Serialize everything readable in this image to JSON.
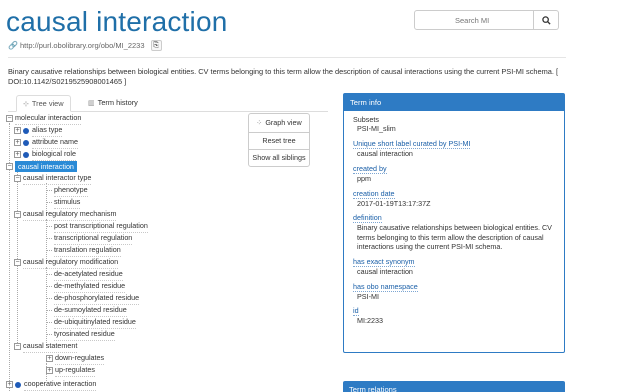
{
  "term": {
    "title": "causal interaction",
    "uri": "http://purl.obolibrary.org/obo/MI_2233",
    "description": "Binary causative relationships between biological entities. CV terms belonging to this term allow the description of causal interactions using the current PSI-MI schema. [ DOI:10.1142/S0219525908001465 ]"
  },
  "search": {
    "placeholder": "Search MI"
  },
  "tabs": [
    {
      "label": "Tree view",
      "icon": "tree-icon"
    },
    {
      "label": "Term history",
      "icon": "bar-chart-icon"
    }
  ],
  "tree": {
    "root": "molecular interaction",
    "items": [
      "alias type",
      "attribute name",
      "biological role",
      "causal interaction",
      "causal interactor type",
      "phenotype",
      "stimulus",
      "causal regulatory mechanism",
      "post transcriptional regulation",
      "transcriptional regulation",
      "translation regulation",
      "causal regulatory modification",
      "de-acetylated residue",
      "de-methylated residue",
      "de-phosphorylated residue",
      "de-sumoylated residue",
      "de-ubiquitinylated residue",
      "tyrosinated residue",
      "causal statement",
      "down-regulates",
      "up-regulates",
      "cooperative interaction"
    ]
  },
  "tree_buttons": {
    "graph_view": "Graph view",
    "reset_tree": "Reset tree",
    "show_all_siblings": "Show all siblings"
  },
  "term_info": {
    "header": "Term info",
    "fields": [
      {
        "key": "Subsets",
        "value": "PSI-MI_slim"
      },
      {
        "key": "Unique short label curated by PSI-MI",
        "value": "causal interaction"
      },
      {
        "key": "created by",
        "value": "ppm"
      },
      {
        "key": "creation date",
        "value": "2017-01-19T13:17:37Z"
      },
      {
        "key": "definition",
        "value": "Binary causative relationships between biological entities. CV terms belonging to this term allow the description of causal interactions using the current PSI-MI schema."
      },
      {
        "key": "has exact synonym",
        "value": "causal interaction"
      },
      {
        "key": "has obo namespace",
        "value": "PSI-MI"
      },
      {
        "key": "id",
        "value": "MI:2233"
      }
    ]
  },
  "term_relations": {
    "header": "Term relations"
  },
  "colors": {
    "accent": "#2e7bc4",
    "title": "#1f6fa8",
    "selected": "#2a8ad6",
    "dot": "#1f5bb8"
  }
}
